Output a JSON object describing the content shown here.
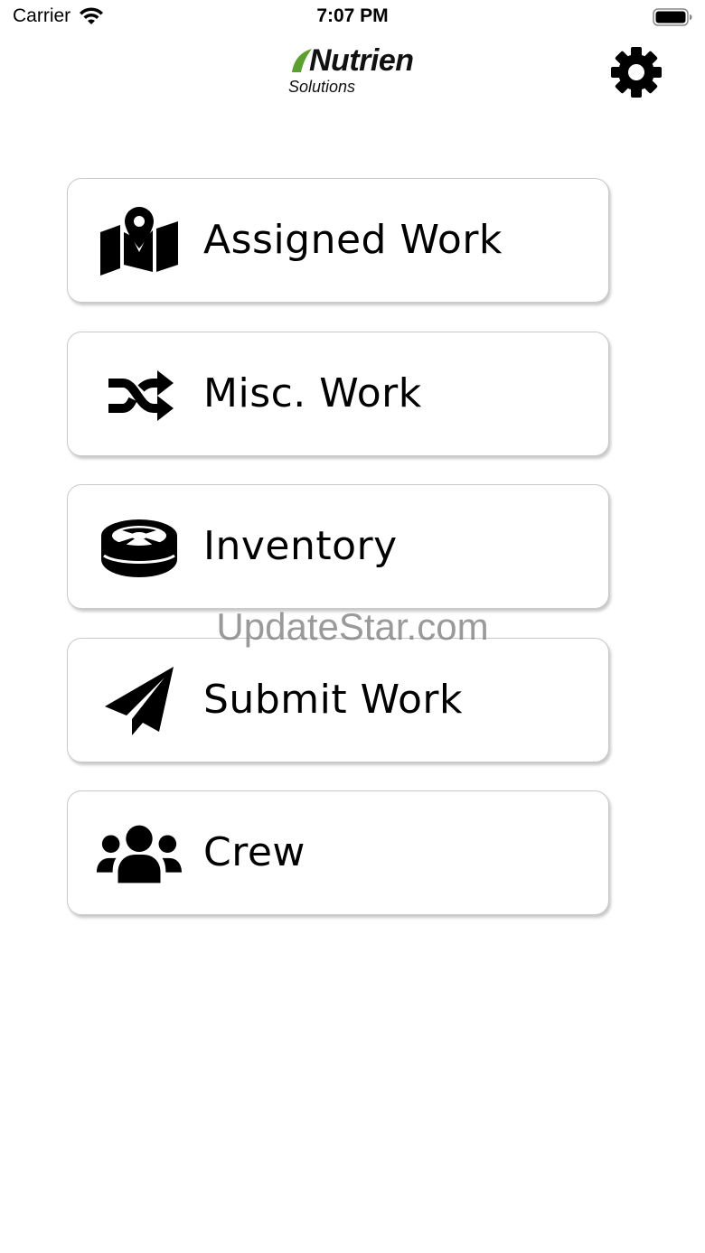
{
  "status_bar": {
    "carrier": "Carrier",
    "time": "7:07 PM"
  },
  "header": {
    "logo_word": "Nutrien",
    "logo_sub": "Solutions",
    "logo_accent_color": "#5aa02c"
  },
  "menu": {
    "items": [
      {
        "label": "Assigned Work",
        "icon": "map-marker-icon"
      },
      {
        "label": "Misc. Work",
        "icon": "shuffle-icon"
      },
      {
        "label": "Inventory",
        "icon": "tape-roll-icon"
      },
      {
        "label": "Submit Work",
        "icon": "paper-plane-icon"
      },
      {
        "label": "Crew",
        "icon": "users-icon"
      }
    ]
  },
  "watermark": "UpdateStar.com"
}
